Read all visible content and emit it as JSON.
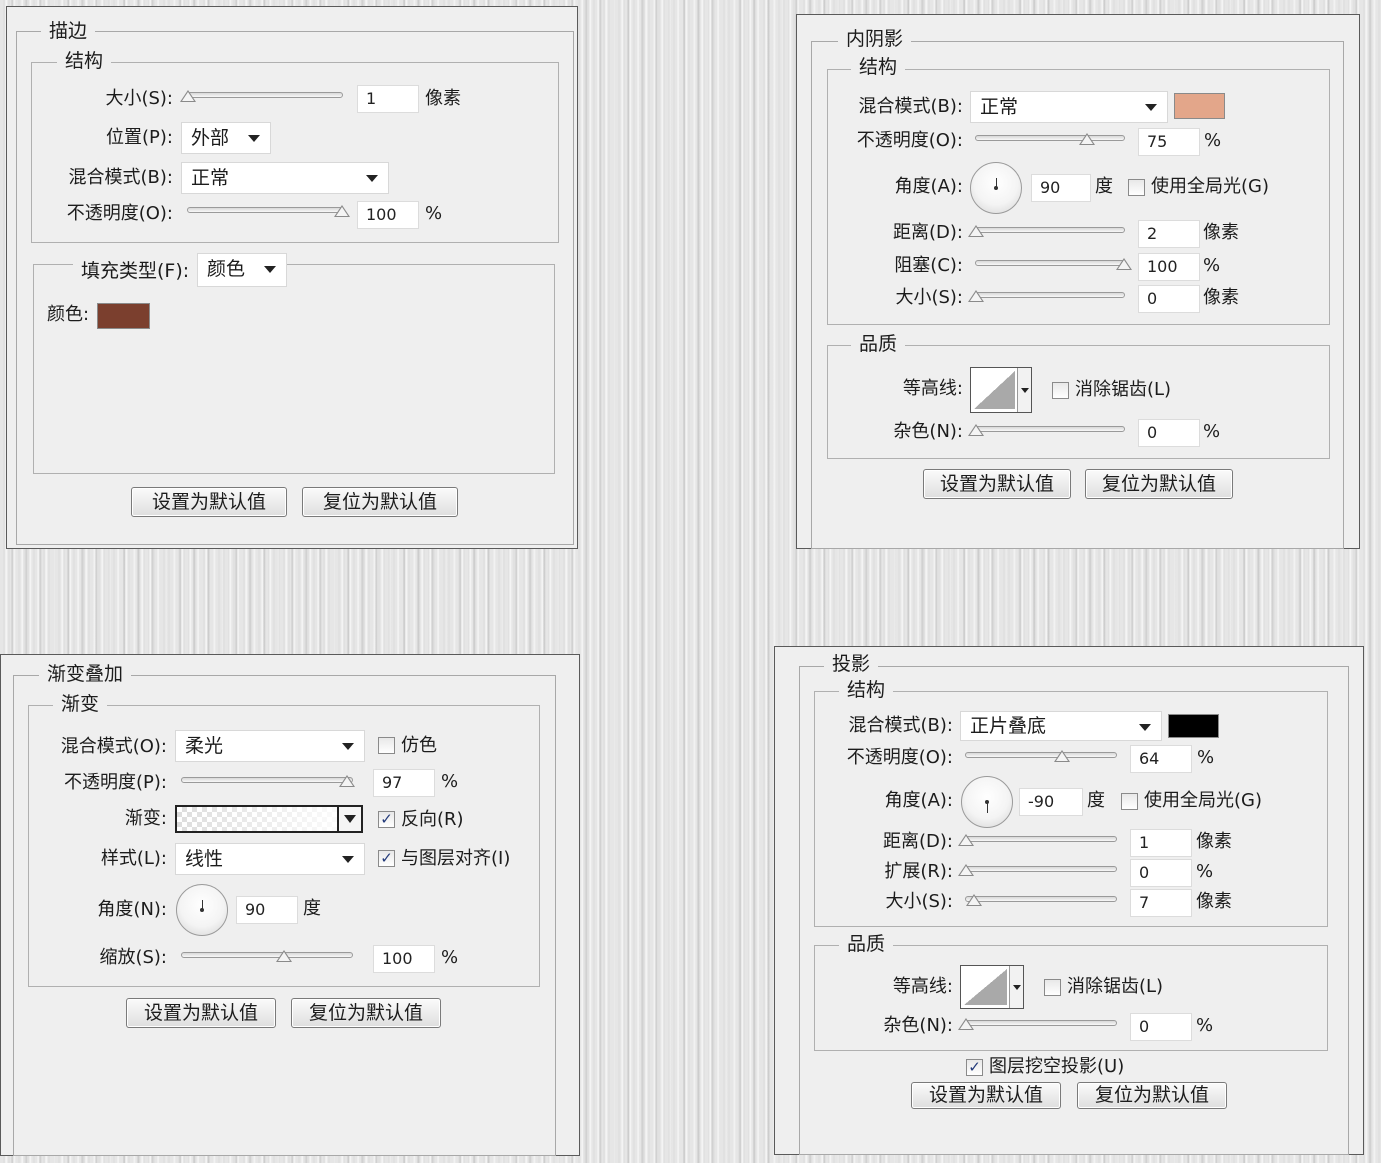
{
  "stroke": {
    "title": "描边",
    "structure_title": "结构",
    "size_label": "大小(S):",
    "size_value": "1",
    "size_unit": "像素",
    "size_level": 0.0,
    "position_label": "位置(P):",
    "position_value": "外部",
    "blend_label": "混合模式(B):",
    "blend_value": "正常",
    "opacity_label": "不透明度(O):",
    "opacity_value": "100",
    "opacity_unit": "%",
    "opacity_level": 1.0,
    "fill_type_label": "填充类型(F):",
    "fill_type_value": "颜色",
    "color_label": "颜色:",
    "color": "#7b3f2e",
    "default_button": "设置为默认值",
    "reset_button": "复位为默认值"
  },
  "inner_shadow": {
    "title": "内阴影",
    "structure_title": "结构",
    "blend_label": "混合模式(B):",
    "blend_value": "正常",
    "color": "#e3a68a",
    "opacity_label": "不透明度(O):",
    "opacity_value": "75",
    "opacity_unit": "%",
    "opacity_level": 0.75,
    "angle_label": "角度(A):",
    "angle_value": "90",
    "angle_unit": "度",
    "global_light_label": "使用全局光(G)",
    "global_light_checked": false,
    "distance_label": "距离(D):",
    "distance_value": "2",
    "distance_unit": "像素",
    "distance_level": 0.0,
    "choke_label": "阻塞(C):",
    "choke_value": "100",
    "choke_unit": "%",
    "choke_level": 1.0,
    "size_label": "大小(S):",
    "size_value": "0",
    "size_unit": "像素",
    "size_level": 0.0,
    "quality_title": "品质",
    "contour_label": "等高线:",
    "antialias_label": "消除锯齿(L)",
    "antialias_checked": false,
    "noise_label": "杂色(N):",
    "noise_value": "0",
    "noise_unit": "%",
    "noise_level": 0.0,
    "default_button": "设置为默认值",
    "reset_button": "复位为默认值"
  },
  "gradient_overlay": {
    "title": "渐变叠加",
    "gradient_title": "渐变",
    "blend_label": "混合模式(O):",
    "blend_value": "柔光",
    "dither_label": "仿色",
    "dither_checked": false,
    "opacity_label": "不透明度(P):",
    "opacity_value": "97",
    "opacity_unit": "%",
    "opacity_level": 0.97,
    "gradient_label": "渐变:",
    "reverse_label": "反向(R)",
    "reverse_checked": true,
    "style_label": "样式(L):",
    "style_value": "线性",
    "align_label": "与图层对齐(I)",
    "align_checked": true,
    "angle_label": "角度(N):",
    "angle_value": "90",
    "angle_unit": "度",
    "scale_label": "缩放(S):",
    "scale_value": "100",
    "scale_unit": "%",
    "scale_level": 0.6,
    "default_button": "设置为默认值",
    "reset_button": "复位为默认值"
  },
  "drop_shadow": {
    "title": "投影",
    "structure_title": "结构",
    "blend_label": "混合模式(B):",
    "blend_value": "正片叠底",
    "color": "#000000",
    "opacity_label": "不透明度(O):",
    "opacity_value": "64",
    "opacity_unit": "%",
    "opacity_level": 0.64,
    "angle_label": "角度(A):",
    "angle_value": "-90",
    "angle_unit": "度",
    "global_light_label": "使用全局光(G)",
    "global_light_checked": false,
    "distance_label": "距离(D):",
    "distance_value": "1",
    "distance_unit": "像素",
    "distance_level": 0.0,
    "spread_label": "扩展(R):",
    "spread_value": "0",
    "spread_unit": "%",
    "spread_level": 0.0,
    "size_label": "大小(S):",
    "size_value": "7",
    "size_unit": "像素",
    "size_level": 0.05,
    "quality_title": "品质",
    "contour_label": "等高线:",
    "antialias_label": "消除锯齿(L)",
    "antialias_checked": false,
    "noise_label": "杂色(N):",
    "noise_value": "0",
    "noise_unit": "%",
    "noise_level": 0.0,
    "knockout_label": "图层挖空投影(U)",
    "knockout_checked": true,
    "default_button": "设置为默认值",
    "reset_button": "复位为默认值"
  }
}
